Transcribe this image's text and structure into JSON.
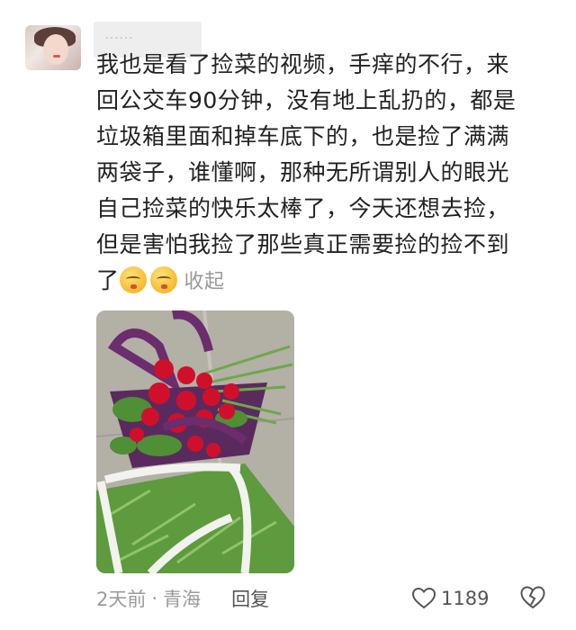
{
  "user": {
    "avatar": "user-avatar",
    "name_masked": "……"
  },
  "comment": {
    "lines": [
      "我也是看了捡菜的视频，手痒的不行，来",
      "回公交车90分钟，没有地上乱扔的，都是",
      "垃圾箱里面和掉车底下的，也是捡了满满",
      "两袋子，谁懂啊，那种无所谓别人的眼光",
      "自己捡菜的快乐太棒了，今天还想去捡，",
      "但是害怕我捡了那些真正需要捡的捡不到",
      "了"
    ],
    "emojis": [
      "blushing-face-emoji",
      "blushing-face-emoji"
    ],
    "collapse_label": "收起"
  },
  "photo": {
    "subject": "radishes-and-herbs-in-bags"
  },
  "meta": {
    "time": "2天前",
    "separator": "·",
    "location": "青海",
    "reply_label": "回复",
    "likes": "1189"
  },
  "colors": {
    "text": "#222222",
    "muted": "#9a9a9a",
    "bag_purple": "#6b2d6e",
    "radish_red": "#d0102a"
  }
}
